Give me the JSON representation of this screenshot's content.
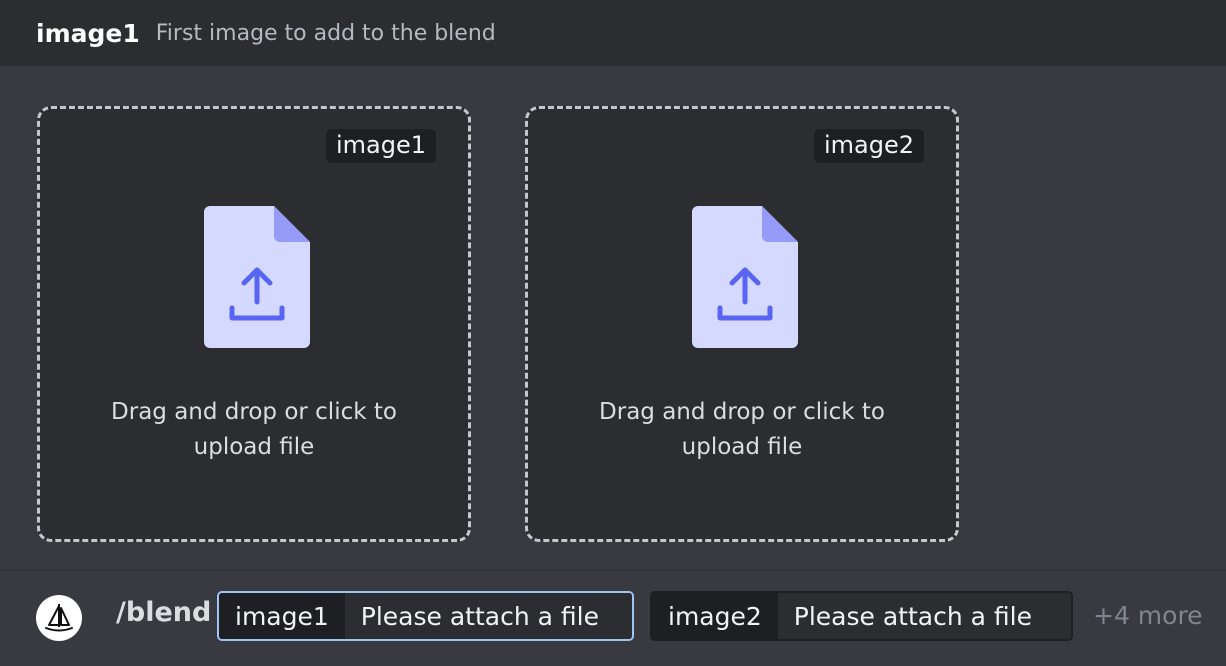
{
  "header": {
    "option_name": "image1",
    "option_description": "First image to add to the blend"
  },
  "dropzones": [
    {
      "tag": "image1",
      "text": "Drag and drop or click to upload file"
    },
    {
      "tag": "image2",
      "text": "Drag and drop or click to upload file"
    }
  ],
  "colors": {
    "file_icon_body": "#d5d8ff",
    "file_icon_accent": "#5865f2",
    "focused_border": "#9ec3f7"
  },
  "command_bar": {
    "avatar_icon": "sailboat-icon",
    "command": "/blend",
    "options": [
      {
        "name": "image1",
        "value": "Please attach a file"
      },
      {
        "name": "image2",
        "value": "Please attach a file"
      }
    ],
    "more": "+4 more"
  }
}
